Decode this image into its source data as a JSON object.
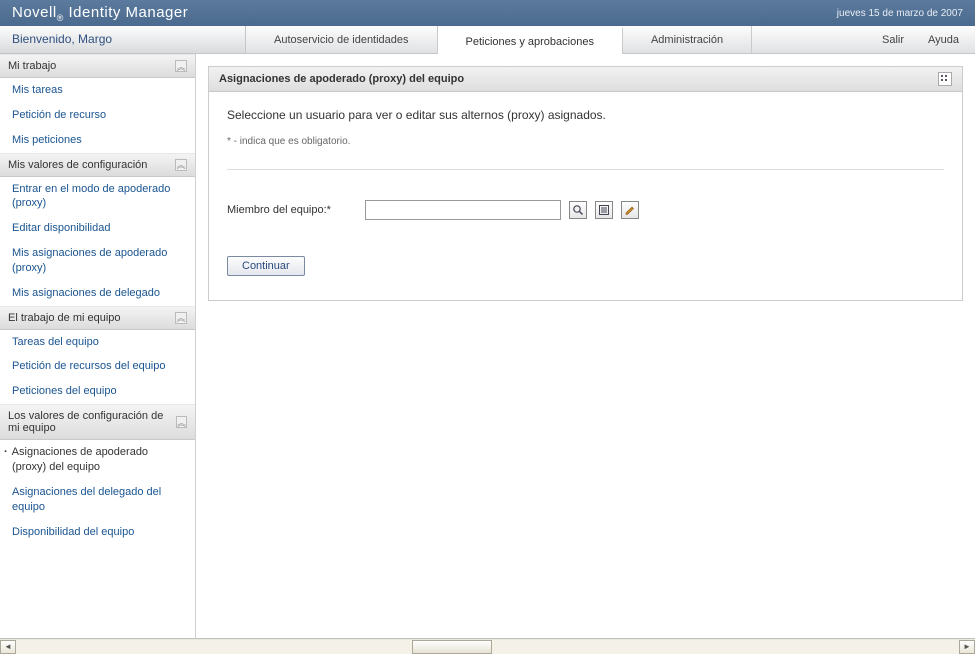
{
  "header": {
    "app_title_prefix": "Novell",
    "app_title_suffix": " Identity Manager",
    "date": "jueves 15 de marzo de 2007"
  },
  "welcome": "Bienvenido, Margo",
  "tabs": [
    {
      "label": "Autoservicio de identidades",
      "active": false
    },
    {
      "label": "Peticiones y aprobaciones",
      "active": true
    },
    {
      "label": "Administración",
      "active": false
    }
  ],
  "nav_right": {
    "logout": "Salir",
    "help": "Ayuda"
  },
  "sidebar": {
    "sections": [
      {
        "title": "Mi trabajo",
        "items": [
          {
            "label": "Mis tareas"
          },
          {
            "label": "Petición de recurso"
          },
          {
            "label": "Mis peticiones"
          }
        ]
      },
      {
        "title": "Mis valores de configuración",
        "items": [
          {
            "label": "Entrar en el modo de apoderado (proxy)"
          },
          {
            "label": "Editar disponibilidad"
          },
          {
            "label": "Mis asignaciones de apoderado (proxy)"
          },
          {
            "label": "Mis asignaciones de delegado"
          }
        ]
      },
      {
        "title": "El trabajo de mi equipo",
        "items": [
          {
            "label": "Tareas del equipo"
          },
          {
            "label": "Petición de recursos del equipo"
          },
          {
            "label": "Peticiones del equipo"
          }
        ]
      },
      {
        "title": "Los valores de configuración de mi equipo",
        "items": [
          {
            "label": "Asignaciones de apoderado (proxy) del equipo",
            "active": true
          },
          {
            "label": "Asignaciones del delegado del equipo"
          },
          {
            "label": "Disponibilidad del equipo"
          }
        ]
      }
    ]
  },
  "panel": {
    "title": "Asignaciones de apoderado (proxy) del equipo",
    "intro": "Seleccione un usuario para ver o editar sus alternos (proxy) asignados.",
    "required_note": "* - indica que es obligatorio.",
    "field_label": "Miembro del equipo:*",
    "field_value": "",
    "continue_label": "Continuar"
  }
}
